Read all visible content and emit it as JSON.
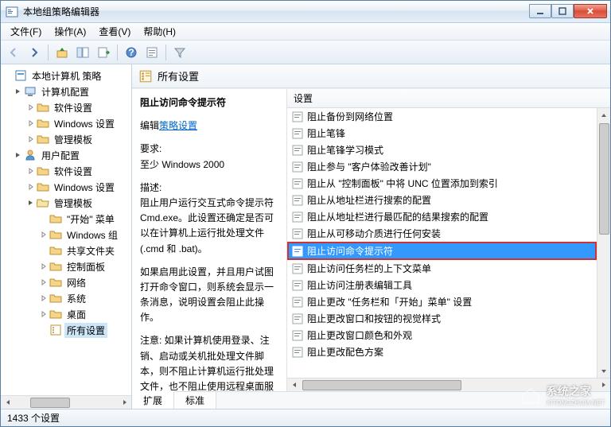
{
  "window": {
    "title": "本地组策略编辑器"
  },
  "menu": {
    "file": "文件(F)",
    "action": "操作(A)",
    "view": "查看(V)",
    "help": "帮助(H)"
  },
  "tree": {
    "root": "本地计算机 策略",
    "computer_config": "计算机配置",
    "cc_software": "软件设置",
    "cc_windows": "Windows 设置",
    "cc_admin": "管理模板",
    "user_config": "用户配置",
    "uc_software": "软件设置",
    "uc_windows": "Windows 设置",
    "uc_admin": "管理模板",
    "start_menu": "\"开始\" 菜单",
    "windows_group": "Windows 组",
    "shared_folders": "共享文件夹",
    "control_panel": "控制面板",
    "network": "网络",
    "system": "系统",
    "desktop": "桌面",
    "all_settings": "所有设置"
  },
  "header": {
    "title": "所有设置"
  },
  "desc": {
    "title": "阻止访问命令提示符",
    "edit_prefix": "编辑",
    "edit_link": "策略设置",
    "req_label": "要求:",
    "req_value": "至少 Windows 2000",
    "desc_label": "描述:",
    "desc_body": "阻止用户运行交互式命令提示符 Cmd.exe。此设置还确定是否可以在计算机上运行批处理文件(.cmd 和 .bat)。",
    "desc_body2": "如果启用此设置，并且用户试图打开命令窗口，则系统会显示一条消息，说明设置会阻止此操作。",
    "desc_body3": "注意: 如果计算机使用登录、注销、启动或关机批处理文件脚本，则不阻止计算机运行批处理文件，也不阻止使用远程桌面服务的用户"
  },
  "list": {
    "header": "设置",
    "items": [
      "阻止备份到网络位置",
      "阻止笔锋",
      "阻止笔锋学习模式",
      "阻止参与 \"客户体验改善计划\"",
      "阻止从 \"控制面板\" 中将 UNC 位置添加到索引",
      "阻止从地址栏进行搜索的配置",
      "阻止从地址栏进行最匹配的结果搜索的配置",
      "阻止从可移动介质进行任何安装",
      "阻止访问命令提示符",
      "阻止访问任务栏的上下文菜单",
      "阻止访问注册表编辑工具",
      "阻止更改 \"任务栏和「开始」菜单\" 设置",
      "阻止更改窗口和按钮的视觉样式",
      "阻止更改窗口颜色和外观",
      "阻止更改配色方案"
    ],
    "selected_index": 8
  },
  "tabs": {
    "extended": "扩展",
    "standard": "标准"
  },
  "status": {
    "count": "1433 个设置"
  },
  "watermark": {
    "text": "系统之家",
    "url": "XITONGZHIJIA.NET"
  }
}
